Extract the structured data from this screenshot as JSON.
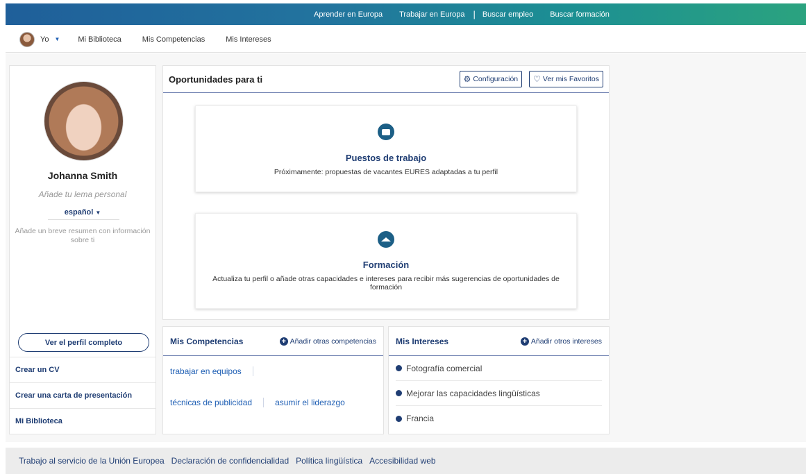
{
  "topbar": {
    "links": [
      "Aprender en Europa",
      "Trabajar en Europa",
      "Buscar empleo",
      "Buscar formación"
    ],
    "separator": "|"
  },
  "subnav": {
    "user_label": "Yo",
    "items": [
      "Mi Biblioteca",
      "Mis Competencias",
      "Mis Intereses"
    ]
  },
  "profile": {
    "name": "Johanna Smith",
    "motto_placeholder": "Añade tu lema personal",
    "language": "español",
    "summary_placeholder": "Añade un breve resumen con información sobre ti",
    "view_button": "Ver el perfil completo",
    "links": [
      "Crear un CV",
      "Crear una carta de presentación",
      "Mi Biblioteca"
    ]
  },
  "opportunities": {
    "title": "Oportunidades para ti",
    "config_button": "Configuración",
    "favorites_button": "Ver mis Favoritos",
    "jobs": {
      "title": "Puestos de trabajo",
      "text": "Próximamente: propuestas de vacantes EURES adaptadas a tu perfil"
    },
    "training": {
      "title": "Formación",
      "text": "Actualiza tu perfil o añade otras capacidades e intereses para recibir más sugerencias de oportunidades de formación"
    }
  },
  "competencies": {
    "title": "Mis Competencias",
    "add_label": "Añadir otras competencias",
    "items": [
      "trabajar en equipos",
      "técnicas de publicidad",
      "asumir el liderazgo"
    ]
  },
  "interests": {
    "title": "Mis Intereses",
    "add_label": "Añadir otros intereses",
    "items": [
      "Fotografía comercial",
      "Mejorar las capacidades lingüísticas",
      "Francia"
    ]
  },
  "footer": {
    "links": [
      "Trabajo al servicio de la Unión Europea",
      "Declaración de confidencialidad",
      "Política lingüística",
      "Accesibilidad web"
    ]
  }
}
